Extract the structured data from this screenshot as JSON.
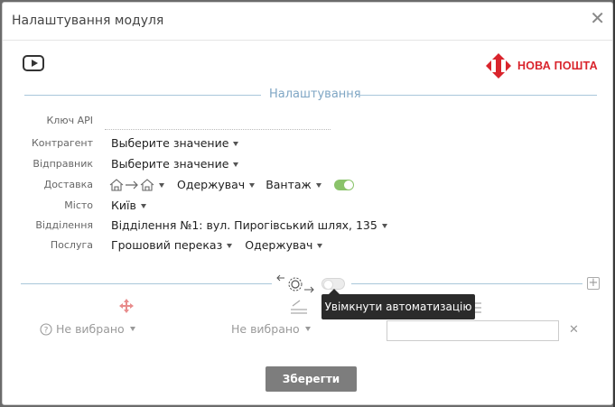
{
  "modal": {
    "title": "Налаштування модуля",
    "close_label": "✕"
  },
  "brand": {
    "logo_text": "НОВА ПОШТА",
    "color": "#d9242c"
  },
  "section": {
    "title": "Налаштування"
  },
  "form": {
    "api_key_label": "Ключ API",
    "api_key_value": "",
    "counterparty_label": "Контрагент",
    "counterparty_value": "Выберите значение",
    "sender_label": "Відправник",
    "sender_value": "Выберите значение",
    "delivery_label": "Доставка",
    "delivery_payer": "Одержувач",
    "delivery_cargo": "Вантаж",
    "city_label": "Місто",
    "city_value": "Київ",
    "branch_label": "Відділення",
    "branch_value": "Відділення №1: вул. Пирогівський шлях, 135",
    "service_label": "Послуга",
    "service_value": "Грошовий переказ",
    "service_payer": "Одержувач"
  },
  "automation": {
    "tooltip": "Увімкнути автоматизацію",
    "not_selected_1": "Не вибрано",
    "not_selected_2": "Не вибрано",
    "plus_label": "+",
    "clear_label": "✕"
  },
  "footer": {
    "save_label": "Зберегти"
  }
}
